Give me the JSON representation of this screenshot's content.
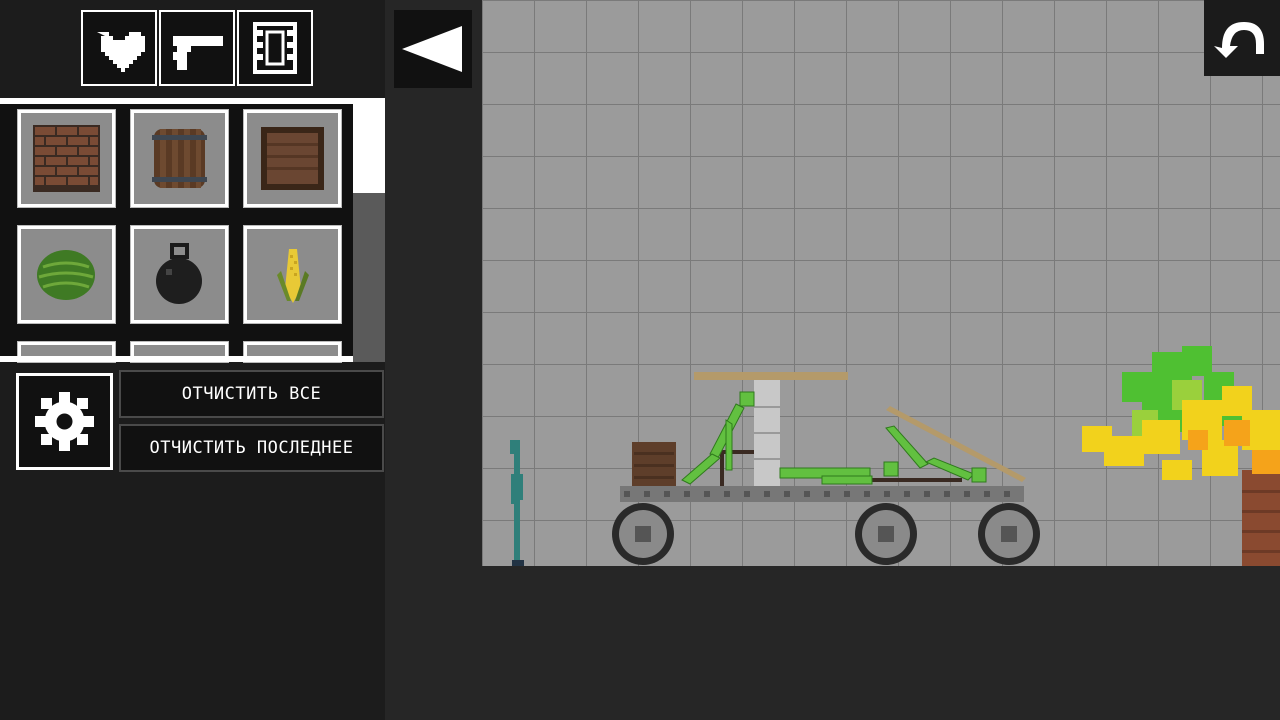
{
  "categories": [
    {
      "icon": "heart-icon"
    },
    {
      "icon": "pistol-icon"
    },
    {
      "icon": "film-frame-icon"
    }
  ],
  "items": [
    {
      "name": "brick-wall",
      "icon": "brick-icon"
    },
    {
      "name": "barrel",
      "icon": "barrel-icon"
    },
    {
      "name": "wooden-crate",
      "icon": "crate-icon"
    },
    {
      "name": "watermelon",
      "icon": "watermelon-icon"
    },
    {
      "name": "weight",
      "icon": "kettlebell-icon"
    },
    {
      "name": "corn",
      "icon": "corn-icon"
    }
  ],
  "buttons": {
    "clear_all": "ОТЧИСТИТЬ ВСЕ",
    "clear_last": "ОТЧИСТИТЬ ПОСЛЕДНЕЕ"
  },
  "icons": {
    "settings": "gear-icon",
    "back": "left-arrow-icon",
    "undo": "undo-arrow-icon"
  },
  "colors": {
    "panel_bg": "#1c1c1c",
    "grid_bg": "#9b9b9b",
    "melon_green": "#5ab43c",
    "fire_yellow": "#f2d21c"
  }
}
